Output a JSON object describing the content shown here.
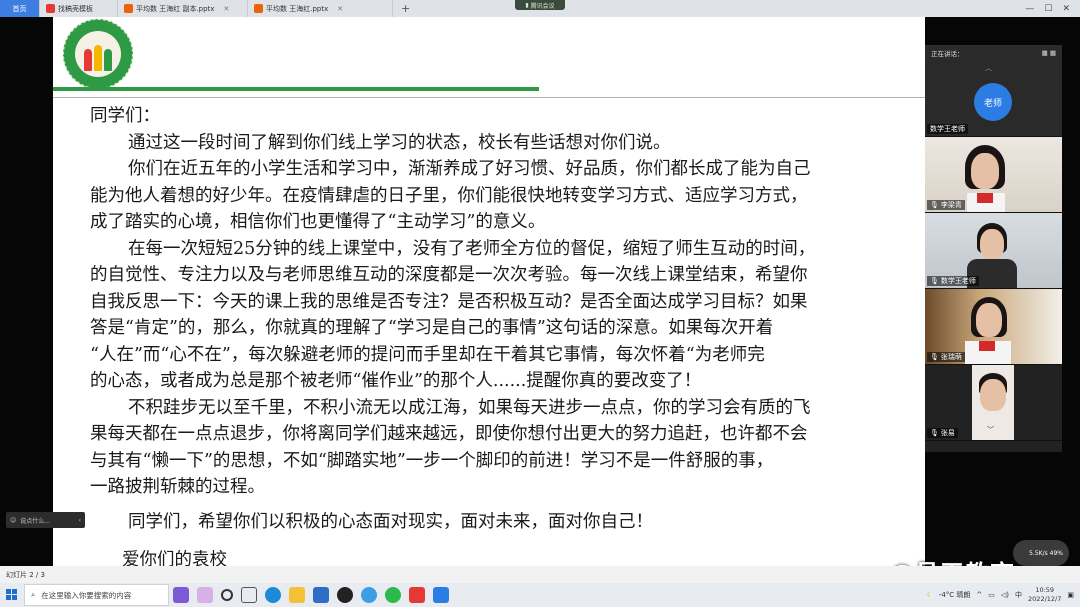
{
  "browser": {
    "tabs": [
      {
        "label": "首页",
        "icon": "home-icon",
        "color": "#3d7fe0"
      },
      {
        "label": "找稿壳模板",
        "icon": "template-icon",
        "color": "#e53935"
      },
      {
        "label": "平均数  王海红 副本.pptx",
        "icon": "pptx-icon",
        "color": "#e8630a"
      },
      {
        "label": "平均数  王海红.pptx",
        "icon": "pptx-icon",
        "color": "#e8630a"
      }
    ],
    "new_tab": "+",
    "meeting_pill": "腾讯会议"
  },
  "slide": {
    "greeting": "同学们：",
    "lines": [
      "通过这一段时间了解到你们线上学习的状态，校长有些话想对你们说。",
      "你们在近五年的小学生活和学习中，渐渐养成了好习惯、好品质，你们都长成了能为自己",
      "能为他人着想的好少年。在疫情肆虐的日子里，你们能很快地转变学习方式、适应学习方式，",
      "成了踏实的心境，相信你们也更懂得了“主动学习”的意义。",
      "在每一次短短25分钟的线上课堂中，没有了老师全方位的督促，缩短了师生互动的时间，",
      "的自觉性、专注力以及与老师思维互动的深度都是一次次考验。每一次线上课堂结束，希望你",
      "自我反思一下：今天的课上我的思维是否专注？是否积极互动？是否全面达成学习目标？如果",
      "答是“肯定”的，那么，你就真的理解了“学习是自己的事情”这句话的深意。如果每次开着",
      "“人在”而“心不在”，每次躲避老师的提问而手里却在干着其它事情，每次怀着“为老师完",
      "的心态，或者成为总是那个被老师“催作业”的那个人......提醒你真的要改变了！",
      "不积跬步无以至千里，不积小流无以成江海，如果每天进步一点点，你的学习会有质的飞",
      "果每天都在一点点退步，你将离同学们越来越远，即使你想付出更大的努力追赶，也许都不会",
      "与其有“懒一下”的思想，不如“脚踏实地”一步一个脚印的前进！学习不是一件舒服的事，",
      "一路披荆斩棘的过程。",
      "同学们，希望你们以积极的心态面对现实，面对未来，面对你自己！"
    ],
    "indented": [
      true,
      true,
      false,
      false,
      true,
      false,
      false,
      false,
      false,
      false,
      true,
      false,
      false,
      false,
      true
    ],
    "signature": "爱你们的袁校",
    "status": "幻灯片 2 / 3"
  },
  "participants": {
    "header": "正在讲话：",
    "tiles": [
      {
        "name": "数学王老师",
        "avatar_text": "老师",
        "type": "avatar"
      },
      {
        "name": "李梁青",
        "type": "girl"
      },
      {
        "name": "数学王老师",
        "type": "teacher"
      },
      {
        "name": "张瑞萌",
        "type": "girl2"
      },
      {
        "name": "张易",
        "type": "boy"
      }
    ]
  },
  "side_tab": "说点什么...",
  "net_speed": "5.5K/s  49%",
  "watermark": "@昌平教育",
  "taskbar": {
    "search_placeholder": "在这里输入你要搜索的内容",
    "weather": "-4°C  晴朗",
    "ime": "中",
    "time": "10:59",
    "date": "2022/12/7"
  }
}
